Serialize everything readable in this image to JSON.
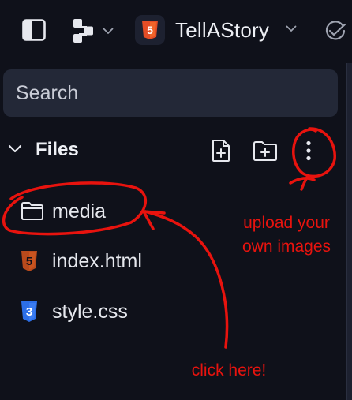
{
  "topbar": {
    "project_name": "TellAStory",
    "icons": [
      "sidebar-toggle-icon",
      "layout-icon",
      "chevron-down-icon",
      "html5-icon",
      "chevron-down-icon",
      "check-circle-icon"
    ],
    "html5_badge": "5"
  },
  "search": {
    "placeholder": "Search"
  },
  "files_panel": {
    "title": "Files",
    "actions": [
      "new-file-icon",
      "new-folder-icon",
      "more-options-icon"
    ],
    "items": [
      {
        "name": "media",
        "icon": "folder-icon",
        "type": "folder"
      },
      {
        "name": "index.html",
        "icon": "html5-file-icon",
        "badge": "5",
        "type": "file"
      },
      {
        "name": "style.css",
        "icon": "css3-file-icon",
        "badge": "3",
        "type": "file"
      }
    ]
  },
  "annotations": {
    "upload_note_line1": "upload your",
    "upload_note_line2": "own images",
    "click_note": "click here!",
    "color": "#e8130e"
  },
  "colors": {
    "background": "#0f111a",
    "search_bg": "#232837",
    "html_orange": "#e44d26",
    "html_file_orange": "#b84a1c",
    "css_blue": "#2c6fe8",
    "text": "#e6e8ee"
  }
}
